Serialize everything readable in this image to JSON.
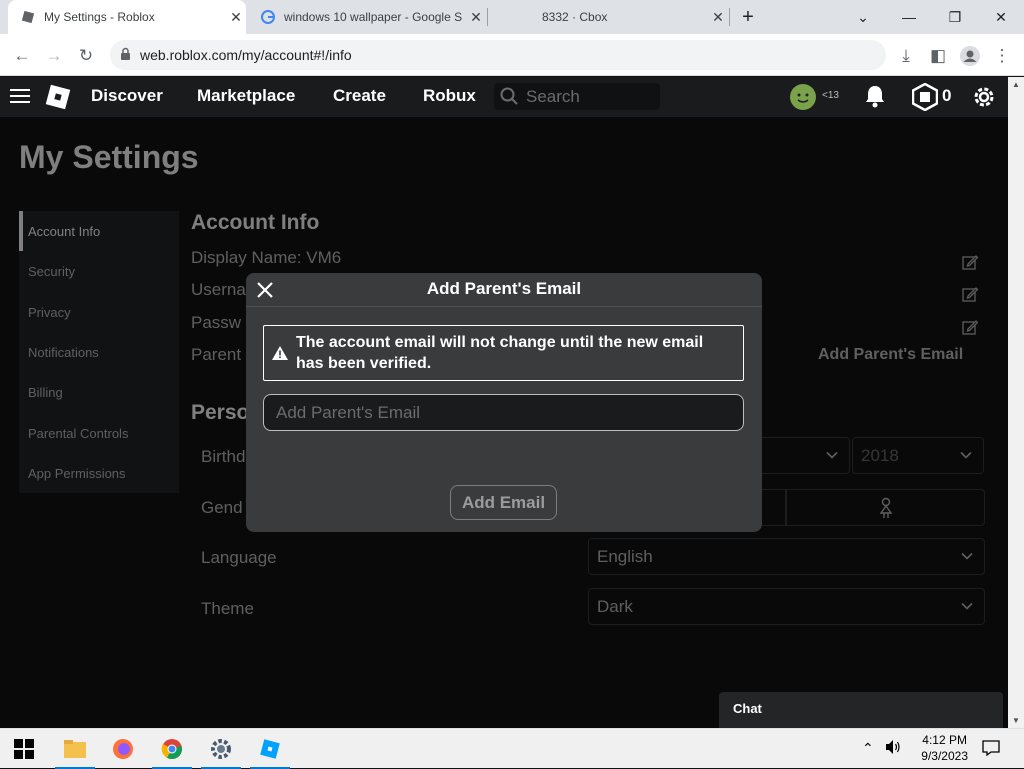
{
  "browser": {
    "tabs": [
      {
        "title": "My Settings - Roblox",
        "active": true
      },
      {
        "title": "windows 10 wallpaper - Google S",
        "active": false
      },
      {
        "title": "8332 · Cbox",
        "active": false
      }
    ],
    "url": "web.roblox.com/my/account#!/info"
  },
  "nav": {
    "links": [
      "Discover",
      "Marketplace",
      "Create",
      "Robux"
    ],
    "search_placeholder": "Search",
    "age_label": "<13",
    "robux_count": "0"
  },
  "page": {
    "title": "My Settings",
    "sidebar": [
      "Account Info",
      "Security",
      "Privacy",
      "Notifications",
      "Billing",
      "Parental Controls",
      "App Permissions"
    ],
    "section_title": "Account Info",
    "display_name_label": "Display Name: VM6",
    "username_label": "Userna",
    "password_label": "Passw",
    "parent_label": "Parent",
    "add_parent_email_link": "Add Parent's Email",
    "personal_title": "Perso",
    "birthday_label": "Birthd",
    "birth_year": "2018",
    "gender_label": "Gend",
    "language_label": "Language",
    "language_value": "English",
    "theme_label": "Theme",
    "theme_value": "Dark"
  },
  "modal": {
    "title": "Add Parent's Email",
    "warning": "The account email will not change until the new email has been verified.",
    "email_placeholder": "Add Parent's Email",
    "submit_label": "Add Email"
  },
  "chat": {
    "label": "Chat"
  },
  "taskbar": {
    "time": "4:12 PM",
    "date": "9/3/2023"
  }
}
